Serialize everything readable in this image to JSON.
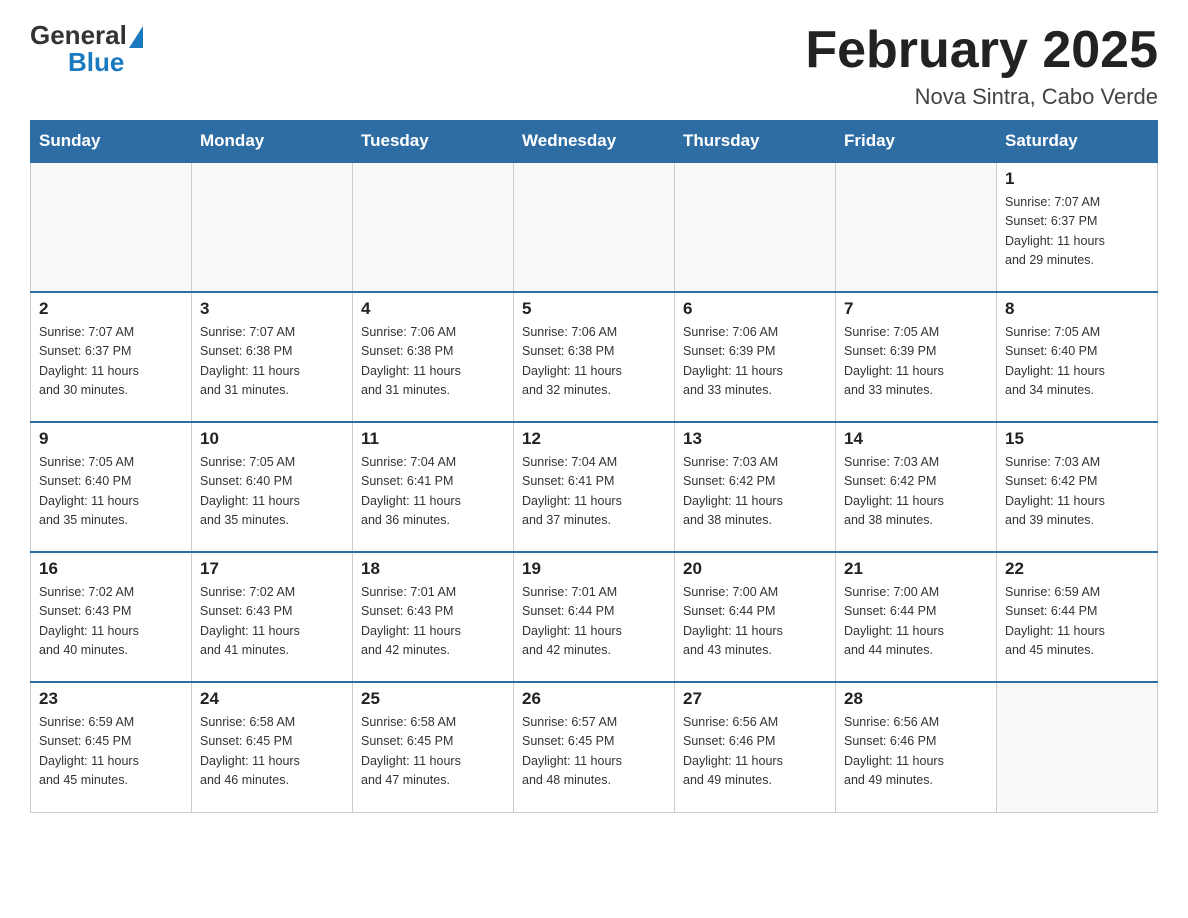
{
  "header": {
    "logo_general": "General",
    "logo_blue": "Blue",
    "month_title": "February 2025",
    "location": "Nova Sintra, Cabo Verde"
  },
  "weekdays": [
    "Sunday",
    "Monday",
    "Tuesday",
    "Wednesday",
    "Thursday",
    "Friday",
    "Saturday"
  ],
  "weeks": [
    [
      {
        "day": "",
        "info": ""
      },
      {
        "day": "",
        "info": ""
      },
      {
        "day": "",
        "info": ""
      },
      {
        "day": "",
        "info": ""
      },
      {
        "day": "",
        "info": ""
      },
      {
        "day": "",
        "info": ""
      },
      {
        "day": "1",
        "info": "Sunrise: 7:07 AM\nSunset: 6:37 PM\nDaylight: 11 hours\nand 29 minutes."
      }
    ],
    [
      {
        "day": "2",
        "info": "Sunrise: 7:07 AM\nSunset: 6:37 PM\nDaylight: 11 hours\nand 30 minutes."
      },
      {
        "day": "3",
        "info": "Sunrise: 7:07 AM\nSunset: 6:38 PM\nDaylight: 11 hours\nand 31 minutes."
      },
      {
        "day": "4",
        "info": "Sunrise: 7:06 AM\nSunset: 6:38 PM\nDaylight: 11 hours\nand 31 minutes."
      },
      {
        "day": "5",
        "info": "Sunrise: 7:06 AM\nSunset: 6:38 PM\nDaylight: 11 hours\nand 32 minutes."
      },
      {
        "day": "6",
        "info": "Sunrise: 7:06 AM\nSunset: 6:39 PM\nDaylight: 11 hours\nand 33 minutes."
      },
      {
        "day": "7",
        "info": "Sunrise: 7:05 AM\nSunset: 6:39 PM\nDaylight: 11 hours\nand 33 minutes."
      },
      {
        "day": "8",
        "info": "Sunrise: 7:05 AM\nSunset: 6:40 PM\nDaylight: 11 hours\nand 34 minutes."
      }
    ],
    [
      {
        "day": "9",
        "info": "Sunrise: 7:05 AM\nSunset: 6:40 PM\nDaylight: 11 hours\nand 35 minutes."
      },
      {
        "day": "10",
        "info": "Sunrise: 7:05 AM\nSunset: 6:40 PM\nDaylight: 11 hours\nand 35 minutes."
      },
      {
        "day": "11",
        "info": "Sunrise: 7:04 AM\nSunset: 6:41 PM\nDaylight: 11 hours\nand 36 minutes."
      },
      {
        "day": "12",
        "info": "Sunrise: 7:04 AM\nSunset: 6:41 PM\nDaylight: 11 hours\nand 37 minutes."
      },
      {
        "day": "13",
        "info": "Sunrise: 7:03 AM\nSunset: 6:42 PM\nDaylight: 11 hours\nand 38 minutes."
      },
      {
        "day": "14",
        "info": "Sunrise: 7:03 AM\nSunset: 6:42 PM\nDaylight: 11 hours\nand 38 minutes."
      },
      {
        "day": "15",
        "info": "Sunrise: 7:03 AM\nSunset: 6:42 PM\nDaylight: 11 hours\nand 39 minutes."
      }
    ],
    [
      {
        "day": "16",
        "info": "Sunrise: 7:02 AM\nSunset: 6:43 PM\nDaylight: 11 hours\nand 40 minutes."
      },
      {
        "day": "17",
        "info": "Sunrise: 7:02 AM\nSunset: 6:43 PM\nDaylight: 11 hours\nand 41 minutes."
      },
      {
        "day": "18",
        "info": "Sunrise: 7:01 AM\nSunset: 6:43 PM\nDaylight: 11 hours\nand 42 minutes."
      },
      {
        "day": "19",
        "info": "Sunrise: 7:01 AM\nSunset: 6:44 PM\nDaylight: 11 hours\nand 42 minutes."
      },
      {
        "day": "20",
        "info": "Sunrise: 7:00 AM\nSunset: 6:44 PM\nDaylight: 11 hours\nand 43 minutes."
      },
      {
        "day": "21",
        "info": "Sunrise: 7:00 AM\nSunset: 6:44 PM\nDaylight: 11 hours\nand 44 minutes."
      },
      {
        "day": "22",
        "info": "Sunrise: 6:59 AM\nSunset: 6:44 PM\nDaylight: 11 hours\nand 45 minutes."
      }
    ],
    [
      {
        "day": "23",
        "info": "Sunrise: 6:59 AM\nSunset: 6:45 PM\nDaylight: 11 hours\nand 45 minutes."
      },
      {
        "day": "24",
        "info": "Sunrise: 6:58 AM\nSunset: 6:45 PM\nDaylight: 11 hours\nand 46 minutes."
      },
      {
        "day": "25",
        "info": "Sunrise: 6:58 AM\nSunset: 6:45 PM\nDaylight: 11 hours\nand 47 minutes."
      },
      {
        "day": "26",
        "info": "Sunrise: 6:57 AM\nSunset: 6:45 PM\nDaylight: 11 hours\nand 48 minutes."
      },
      {
        "day": "27",
        "info": "Sunrise: 6:56 AM\nSunset: 6:46 PM\nDaylight: 11 hours\nand 49 minutes."
      },
      {
        "day": "28",
        "info": "Sunrise: 6:56 AM\nSunset: 6:46 PM\nDaylight: 11 hours\nand 49 minutes."
      },
      {
        "day": "",
        "info": ""
      }
    ]
  ]
}
